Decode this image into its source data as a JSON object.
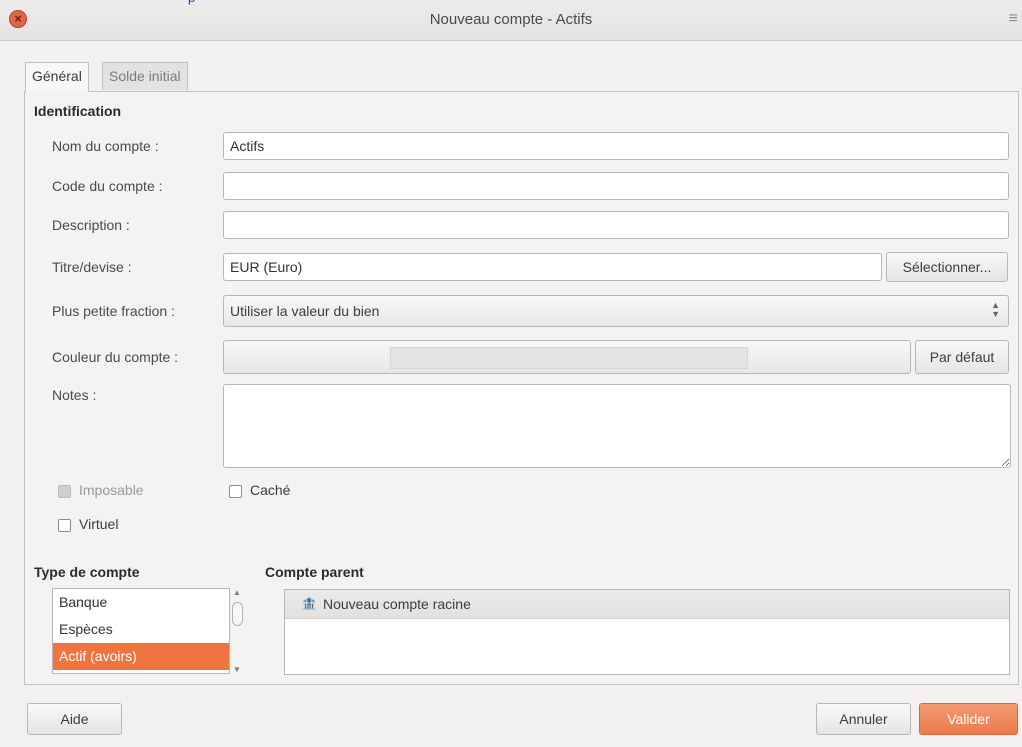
{
  "window": {
    "title": "Nouveau compte - Actifs",
    "top_link": "p"
  },
  "tabs": [
    {
      "label": "Général"
    },
    {
      "label": "Solde initial"
    }
  ],
  "identification": {
    "section_title": "Identification",
    "name_label": "Nom du compte :",
    "name_value": "Actifs",
    "code_label": "Code du compte :",
    "code_value": "",
    "description_label": "Description :",
    "description_value": "",
    "security_label": "Titre/devise :",
    "security_value": "EUR (Euro)",
    "select_button": "Sélectionner...",
    "fraction_label": "Plus petite fraction :",
    "fraction_value": "Utiliser la valeur du bien",
    "color_label": "Couleur du compte :",
    "default_button": "Par défaut",
    "notes_label": "Notes :",
    "notes_value": ""
  },
  "checkboxes": {
    "taxable": {
      "label": "Imposable",
      "checked": false,
      "enabled": false
    },
    "hidden": {
      "label": "Caché",
      "checked": false
    },
    "placeholder": {
      "label": "Virtuel",
      "checked": false
    }
  },
  "account_type": {
    "section_title": "Type de compte",
    "items": [
      "Banque",
      "Espèces",
      "Actif (avoirs)"
    ],
    "selected": "Actif (avoirs)"
  },
  "parent_account": {
    "section_title": "Compte parent",
    "items": [
      {
        "label": "Nouveau compte racine",
        "icon": "bank-icon"
      }
    ]
  },
  "footer": {
    "help": "Aide",
    "cancel": "Annuler",
    "ok": "Valider"
  },
  "colors": {
    "accent": "#ef7440",
    "close": "#e0654a"
  }
}
